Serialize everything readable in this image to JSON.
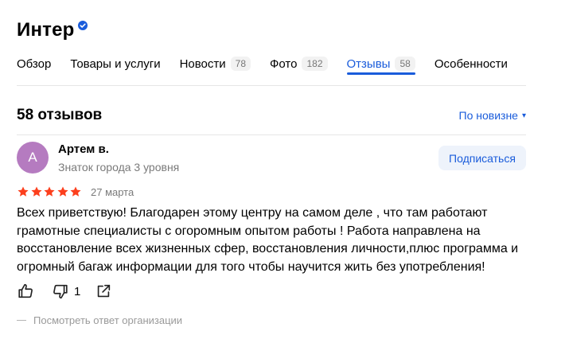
{
  "org": {
    "title": "Интер"
  },
  "tabs": [
    {
      "label": "Обзор",
      "count": null
    },
    {
      "label": "Товары и услуги",
      "count": null
    },
    {
      "label": "Новости",
      "count": "78"
    },
    {
      "label": "Фото",
      "count": "182"
    },
    {
      "label": "Отзывы",
      "count": "58",
      "active": true
    },
    {
      "label": "Особенности",
      "count": null
    }
  ],
  "reviews": {
    "heading": "58 отзывов",
    "sort_label": "По новизне",
    "sort_caret": "▾"
  },
  "review": {
    "avatar_letter": "А",
    "author": "Артем в.",
    "level": "Знаток города 3 уровня",
    "subscribe_label": "Подписаться",
    "rating": 5,
    "date": "27 марта",
    "text": "Всех приветствую! Благодарен этому центру на самом деле , что там работают грамотные специалисты с огоромным опытом работы ! Работа направлена на восстановление всех жизненных сфер, восстановления личности,плюс программа и огромный багаж информации для того чтобы научится жить без употребления!",
    "dislike_count": "1",
    "org_reply_link": "Посмотреть ответ организации"
  },
  "colors": {
    "accent": "#1a5cdb",
    "star": "#fc3f1d",
    "avatar_bg": "#b57bc0",
    "verified": "#1a5cdb"
  },
  "icons": [
    "verified-icon",
    "star-icon",
    "like-icon",
    "dislike-icon",
    "share-icon",
    "chevron-down-icon"
  ]
}
